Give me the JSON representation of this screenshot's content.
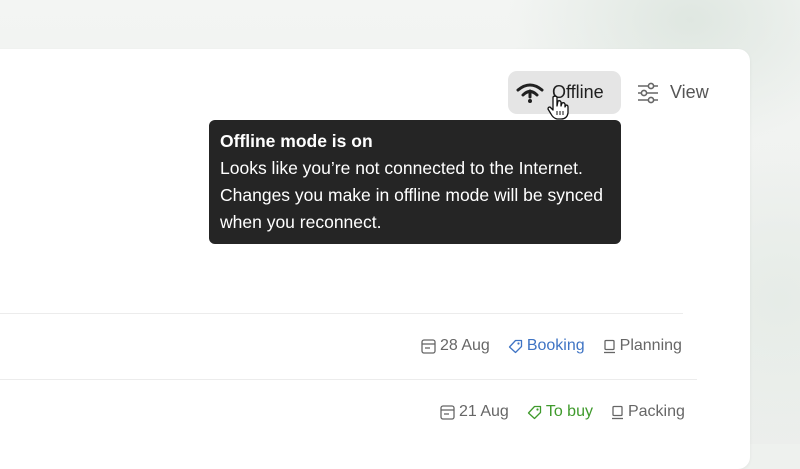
{
  "toolbar": {
    "offline_label": "Offline",
    "view_label": "View"
  },
  "tooltip": {
    "title": "Offline mode is on",
    "body": "Looks like you’re not connected to the Internet. Changes you make in offline mode will be synced when you reconnect."
  },
  "tasks": [
    {
      "date": "28 Aug",
      "label": "Booking",
      "label_color": "#3f74c4",
      "project": "Planning"
    },
    {
      "date": "21 Aug",
      "label": "To buy",
      "label_color": "#3f9a2c",
      "project": "Packing"
    }
  ],
  "icons": {
    "offline": "wifi-off-icon",
    "view": "sliders-icon",
    "date": "calendar-icon",
    "label": "tag-icon",
    "project": "section-icon",
    "cursor": "hand-cursor-icon"
  }
}
